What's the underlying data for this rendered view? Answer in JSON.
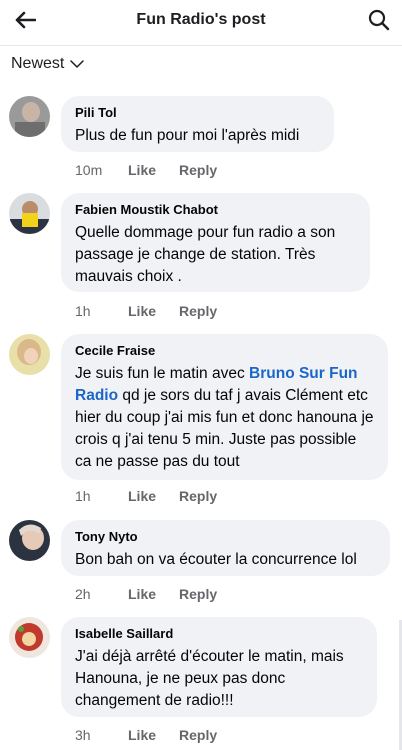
{
  "header": {
    "title": "Fun Radio's post",
    "back_icon": "arrow-left-icon",
    "search_icon": "search-icon"
  },
  "sort": {
    "label": "Newest"
  },
  "comments": [
    {
      "author": "Pili Tol",
      "text": "Plus de fun pour moi l'après midi",
      "time": "10m",
      "like": "Like",
      "reply": "Reply"
    },
    {
      "author": "Fabien Moustik Chabot",
      "text": "Quelle dommage pour fun radio a son passage je change de station. Très mauvais choix .",
      "time": "1h",
      "like": "Like",
      "reply": "Reply"
    },
    {
      "author": "Cecile Fraise",
      "text_before": "Je suis fun le matin avec ",
      "mention": "Bruno Sur Fun Radio",
      "text_after": " qd je sors du taf j avais Clément etc hier du coup j'ai mis fun et donc hanouna je crois q j'ai tenu 5 min.  Juste pas possible ca ne passe pas du tout",
      "time": "1h",
      "like": "Like",
      "reply": "Reply"
    },
    {
      "author": "Tony Nyto",
      "text": "Bon bah on va écouter la concurrence lol",
      "time": "2h",
      "like": "Like",
      "reply": "Reply"
    },
    {
      "author": "Isabelle Saillard",
      "text": "J'ai déjà arrêté d'écouter le matin, mais Hanouna, je ne peux pas donc changement de radio!!!",
      "time": "3h",
      "like": "Like",
      "reply": "Reply"
    }
  ]
}
